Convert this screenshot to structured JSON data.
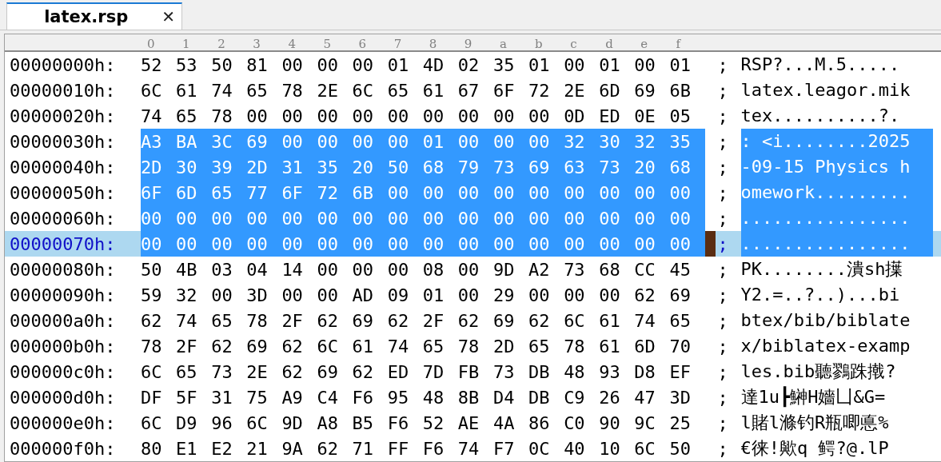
{
  "tabs": [
    {
      "label": "latex.rsp",
      "close": "✕",
      "selected": true
    }
  ],
  "ruler": [
    "0",
    "1",
    "2",
    "3",
    "4",
    "5",
    "6",
    "7",
    "8",
    "9",
    "a",
    "b",
    "c",
    "d",
    "e",
    "f"
  ],
  "rows": [
    {
      "offset": "00000000h:",
      "bytes": "52 53 50 81 00 00 00 01 4D 02 35 01 00 01 00 01",
      "sep": ";",
      "ascii": "RSP?...M.5.....",
      "selected": false,
      "current": false
    },
    {
      "offset": "00000010h:",
      "bytes": "6C 61 74 65 78 2E 6C 65 61 67 6F 72 2E 6D 69 6B",
      "sep": ";",
      "ascii": "latex.leagor.mik",
      "selected": false,
      "current": false
    },
    {
      "offset": "00000020h:",
      "bytes": "74 65 78 00 00 00 00 00 00 00 00 00 0D ED 0E 05",
      "sep": ";",
      "ascii": "tex..........?.",
      "selected": false,
      "current": false
    },
    {
      "offset": "00000030h:",
      "bytes": "A3 BA 3C 69 00 00 00 00 01 00 00 00 32 30 32 35",
      "sep": ";",
      "ascii": ": <i........2025",
      "selected": true,
      "current": false
    },
    {
      "offset": "00000040h:",
      "bytes": "2D 30 39 2D 31 35 20 50 68 79 73 69 63 73 20 68",
      "sep": ";",
      "ascii": "-09-15 Physics h",
      "selected": true,
      "current": false
    },
    {
      "offset": "00000050h:",
      "bytes": "6F 6D 65 77 6F 72 6B 00 00 00 00 00 00 00 00 00",
      "sep": ";",
      "ascii": "omework.........",
      "selected": true,
      "current": false
    },
    {
      "offset": "00000060h:",
      "bytes": "00 00 00 00 00 00 00 00 00 00 00 00 00 00 00 00",
      "sep": ";",
      "ascii": "................",
      "selected": true,
      "current": false
    },
    {
      "offset": "00000070h:",
      "bytes": "00 00 00 00 00 00 00 00 00 00 00 00 00 00 00 00",
      "sep": ";",
      "ascii": "................",
      "selected": true,
      "current": true
    },
    {
      "offset": "00000080h:",
      "bytes": "50 4B 03 04 14 00 00 00 08 00 9D A2 73 68 CC 45",
      "sep": ";",
      "ascii": "PK........潰sh擛",
      "selected": false,
      "current": false
    },
    {
      "offset": "00000090h:",
      "bytes": "59 32 00 3D 00 00 AD 09 01 00 29 00 00 00 62 69",
      "sep": ";",
      "ascii": "Y2.=..?..)...bi",
      "selected": false,
      "current": false
    },
    {
      "offset": "000000a0h:",
      "bytes": "62 74 65 78 2F 62 69 62 2F 62 69 62 6C 61 74 65",
      "sep": ";",
      "ascii": "btex/bib/biblate",
      "selected": false,
      "current": false
    },
    {
      "offset": "000000b0h:",
      "bytes": "78 2F 62 69 62 6C 61 74 65 78 2D 65 78 61 6D 70",
      "sep": ";",
      "ascii": "x/biblatex-examp",
      "selected": false,
      "current": false
    },
    {
      "offset": "000000c0h:",
      "bytes": "6C 65 73 2E 62 69 62 ED 7D FB 73 DB 48 93 D8 EF",
      "sep": ";",
      "ascii": "les.bib聽鷚跦撠?",
      "selected": false,
      "current": false
    },
    {
      "offset": "000000d0h:",
      "bytes": "DF 5F 31 75 A9 C4 F6 95 48 8B D4 DB C9 26 47 3D",
      "sep": ";",
      "ascii": "達1u┣鰰H嬙凵&G=",
      "selected": false,
      "current": false
    },
    {
      "offset": "000000e0h:",
      "bytes": "6C D9 96 6C 9D A8 B5 F6 52 AE 4A 86 C0 90 9C 25",
      "sep": ";",
      "ascii": "l賭l滌钓R瓶唧悳%",
      "selected": false,
      "current": false
    },
    {
      "offset": "000000f0h:",
      "bytes": "80 E1 E2 21 9A 62 71 FF F6 74 F7 0C 40 10 6C 50",
      "sep": ";",
      "ascii": "€徕!歟q  鳄?@.lP",
      "selected": false,
      "current": false
    }
  ]
}
